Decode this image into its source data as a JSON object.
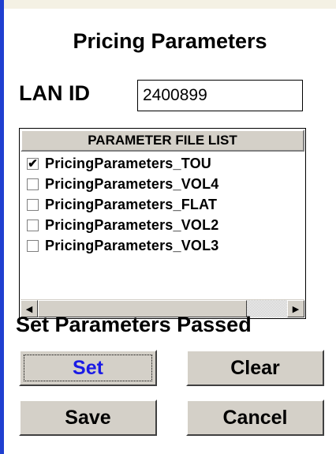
{
  "window": {
    "title": "Pricing Parameters"
  },
  "lan": {
    "label": "LAN ID",
    "value": "2400899"
  },
  "parameter_list": {
    "header": "PARAMETER FILE LIST",
    "items": [
      {
        "label": "PricingParameters_TOU",
        "checked": true
      },
      {
        "label": "PricingParameters_VOL4",
        "checked": false
      },
      {
        "label": "PricingParameters_FLAT",
        "checked": false
      },
      {
        "label": "PricingParameters_VOL2",
        "checked": false
      },
      {
        "label": "PricingParameters_VOL3",
        "checked": false
      }
    ],
    "check_glyph": "✔"
  },
  "status": {
    "text": "Set Parameters Passed"
  },
  "buttons": {
    "set": "Set",
    "clear": "Clear",
    "save": "Save",
    "cancel": "Cancel"
  },
  "colors": {
    "accent_border": "#1f3fd0",
    "face": "#d4d0c8",
    "set_text": "#1a1ae6"
  }
}
